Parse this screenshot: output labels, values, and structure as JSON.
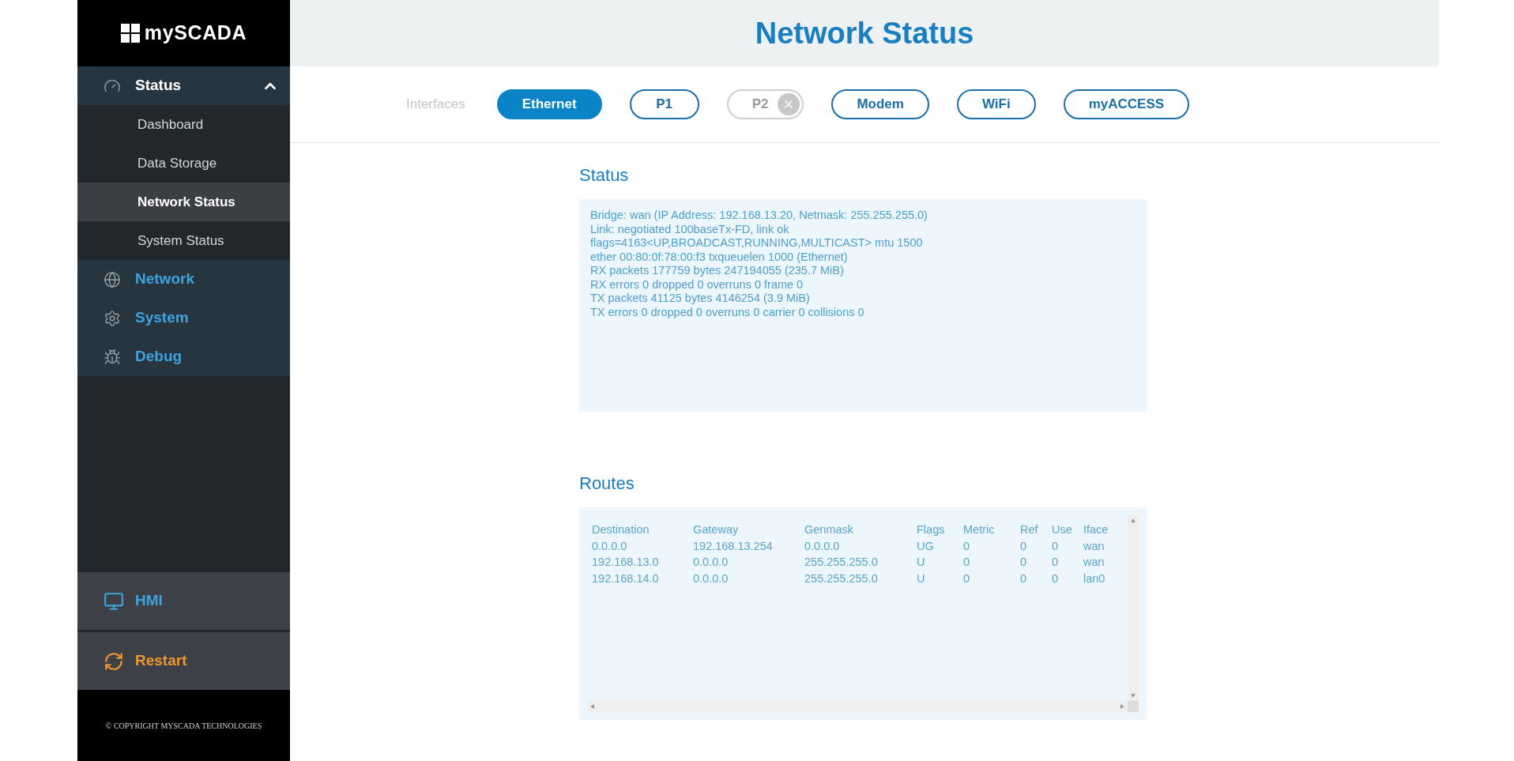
{
  "sidebar": {
    "logo": "mySCADA",
    "status_group": {
      "label": "Status",
      "expanded": true,
      "items": [
        {
          "label": "Dashboard",
          "selected": false
        },
        {
          "label": "Data Storage",
          "selected": false
        },
        {
          "label": "Network Status",
          "selected": true
        },
        {
          "label": "System Status",
          "selected": false
        }
      ]
    },
    "sections": [
      {
        "label": "Network"
      },
      {
        "label": "System"
      },
      {
        "label": "Debug"
      }
    ],
    "hmi": "HMI",
    "restart": "Restart",
    "copyright": "© COPYRIGHT MYSCADA TECHNOLOGIES"
  },
  "header": {
    "title": "Network Status"
  },
  "interfaces": {
    "label": "Interfaces",
    "tabs": [
      {
        "label": "Ethernet",
        "selected": true,
        "disabled": false
      },
      {
        "label": "P1",
        "selected": false,
        "disabled": false
      },
      {
        "label": "P2",
        "selected": false,
        "disabled": true
      },
      {
        "label": "Modem",
        "selected": false,
        "disabled": false
      },
      {
        "label": "WiFi",
        "selected": false,
        "disabled": false
      },
      {
        "label": "myACCESS",
        "selected": false,
        "disabled": false
      }
    ]
  },
  "status": {
    "title": "Status",
    "lines": [
      "Bridge: wan (IP Address: 192.168.13.20, Netmask: 255.255.255.0)",
      "Link: negotiated 100baseTx-FD, link ok",
      "flags=4163<UP,BROADCAST,RUNNING,MULTICAST> mtu 1500",
      "ether 00:80:0f:78:00:f3 txqueuelen 1000 (Ethernet)",
      "RX packets 177759 bytes 247194055 (235.7 MiB)",
      "RX errors 0 dropped 0 overruns 0 frame 0",
      "TX packets 41125 bytes 4146254 (3.9 MiB)",
      "TX errors 0 dropped 0 overruns 0 carrier 0 collisions 0"
    ]
  },
  "routes": {
    "title": "Routes",
    "columns": [
      "Destination",
      "Gateway",
      "Genmask",
      "Flags",
      "Metric",
      "Ref",
      "Use",
      "Iface"
    ],
    "rows": [
      [
        "0.0.0.0",
        "192.168.13.254",
        "0.0.0.0",
        "UG",
        "0",
        "0",
        "0",
        "wan"
      ],
      [
        "192.168.13.0",
        "0.0.0.0",
        "255.255.255.0",
        "U",
        "0",
        "0",
        "0",
        "wan"
      ],
      [
        "192.168.14.0",
        "0.0.0.0",
        "255.255.255.0",
        "U",
        "0",
        "0",
        "0",
        "lan0"
      ]
    ]
  }
}
